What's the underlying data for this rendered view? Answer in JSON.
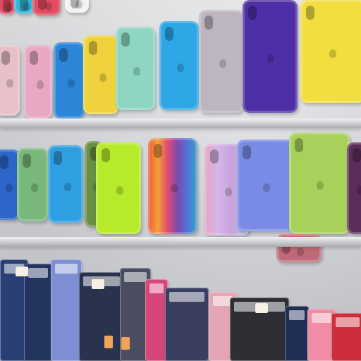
{
  "scene": {
    "kind": "retail-wall-display",
    "colors": {
      "wall": "#d7d8dc",
      "rail": "#c6c8cc",
      "case_colors": [
        "#3f3aa0",
        "#f2d43c",
        "#7b4db5",
        "#34a7e6",
        "#9ad2c7",
        "#e7a9c1",
        "#bfb6c9",
        "#2e74c9",
        "#a6e05a",
        "#c7d55c",
        "#5c7bd8",
        "#2b2f44"
      ]
    }
  }
}
